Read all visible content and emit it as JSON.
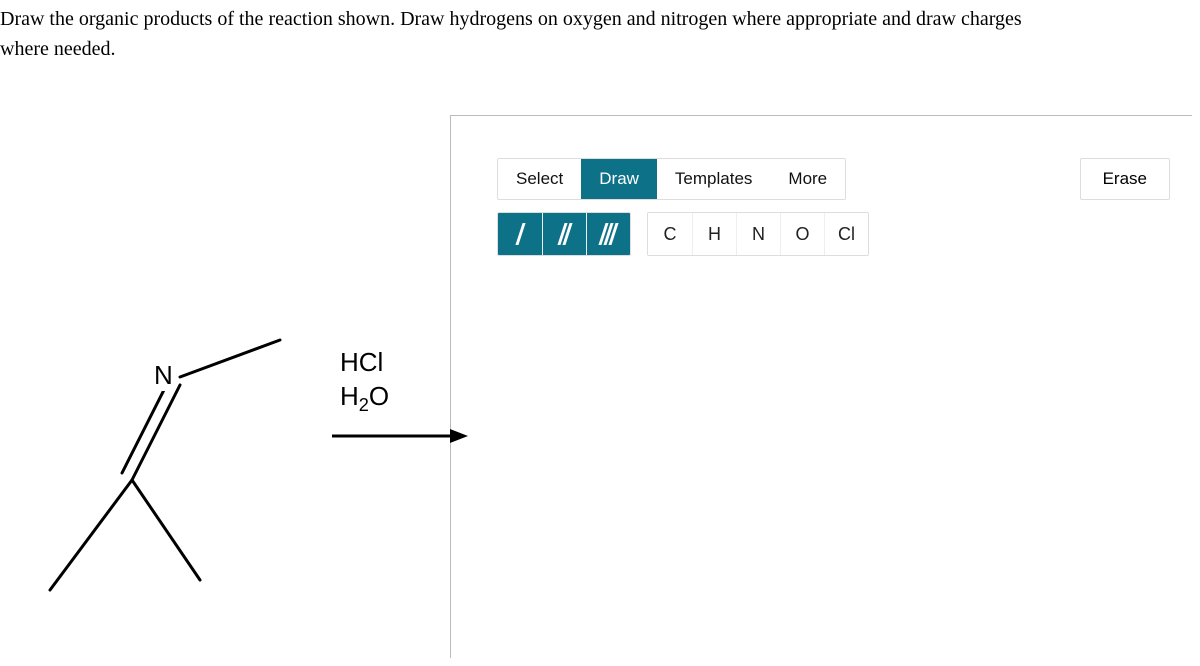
{
  "question": {
    "line1": "Draw the organic products of the reaction shown. Draw hydrogens on oxygen and nitrogen where appropriate and draw charges",
    "line2": "where needed."
  },
  "toolbar": {
    "modes": {
      "select": "Select",
      "draw": "Draw",
      "templates": "Templates",
      "more": "More"
    },
    "erase": "Erase",
    "elements": {
      "c": "C",
      "h": "H",
      "n": "N",
      "o": "O",
      "cl": "Cl"
    },
    "bond_icons": {
      "single": "single-bond-icon",
      "double": "double-bond-icon",
      "triple": "triple-bond-icon"
    }
  },
  "reaction": {
    "atom_n": "N",
    "reagent1": "HCl",
    "reagent2_prefix": "H",
    "reagent2_sub": "2",
    "reagent2_suffix": "O"
  }
}
